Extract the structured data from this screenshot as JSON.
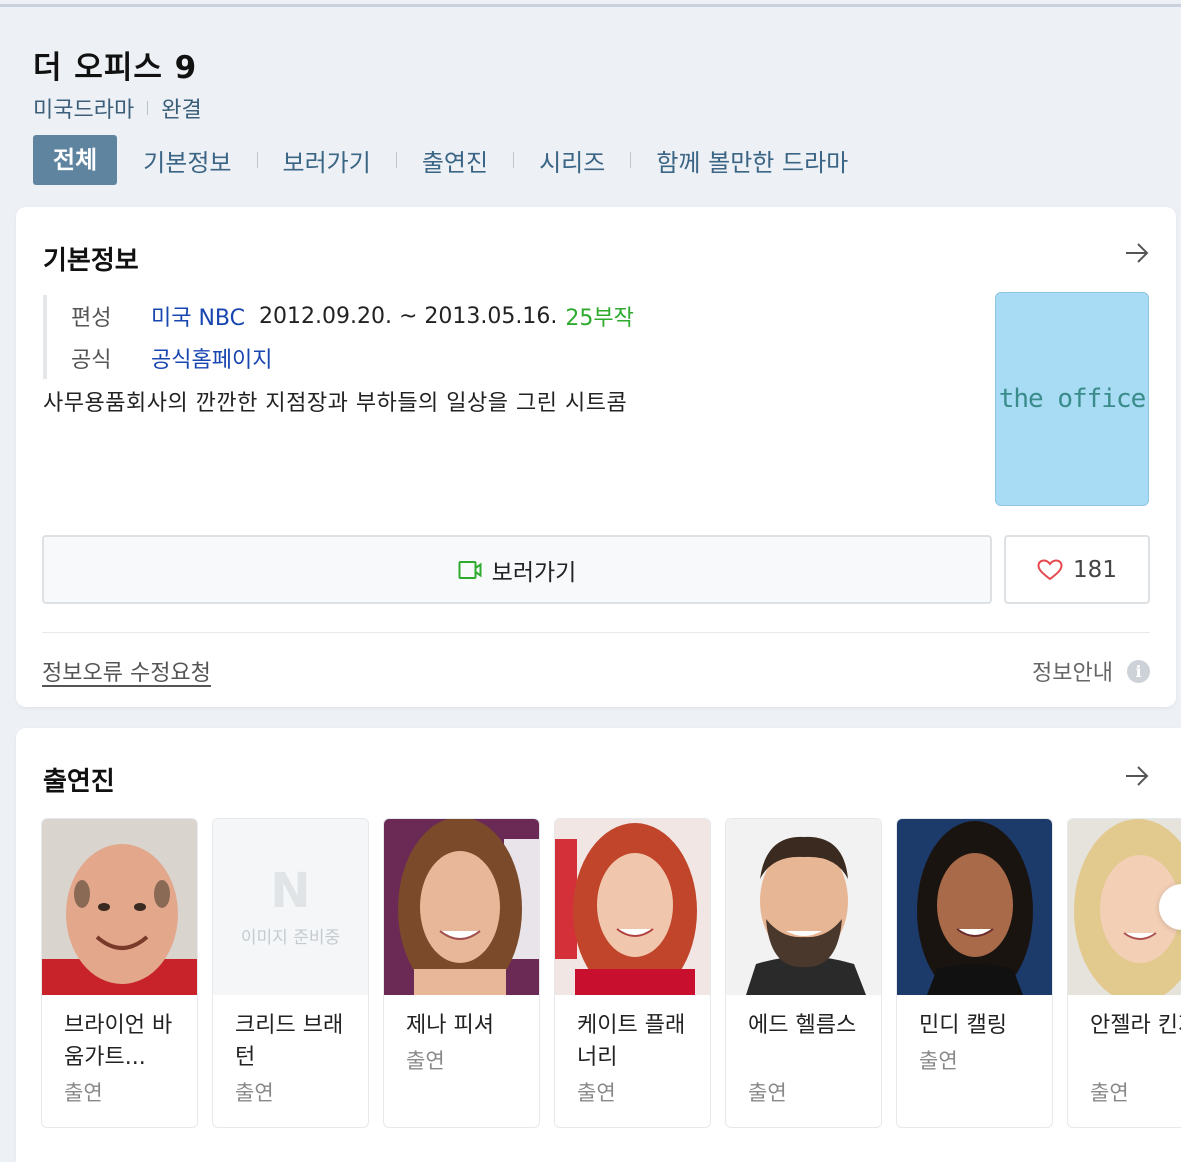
{
  "header": {
    "title": "더 오피스 9",
    "genre": "미국드라마",
    "status": "완결"
  },
  "tabs": [
    {
      "label": "전체",
      "active": true
    },
    {
      "label": "기본정보"
    },
    {
      "label": "보러가기"
    },
    {
      "label": "출연진"
    },
    {
      "label": "시리즈"
    },
    {
      "label": "함께 볼만한 드라마"
    }
  ],
  "basic_info": {
    "title": "기본정보",
    "broadcast_label": "편성",
    "broadcaster": "미국 NBC",
    "period": "2012.09.20. ~ 2013.05.16.",
    "episodes": "25부작",
    "official_label": "공식",
    "homepage": "공식홈페이지",
    "description": "사무용품회사의 깐깐한 지점장과 부하들의 일상을 그린 시트콤",
    "poster_text": "the office",
    "watch_label": "보러가기",
    "like_count": "181",
    "report_label": "정보오류 수정요청",
    "info_label": "정보안내",
    "info_icon": "i"
  },
  "cast": {
    "title": "출연진",
    "placeholder_logo": "N",
    "placeholder_text": "이미지 준비중",
    "members": [
      {
        "name": "브라이언 바움가트...",
        "role": "출연",
        "photo": "bald-man"
      },
      {
        "name": "크리드 브래턴",
        "role": "출연",
        "photo": "placeholder"
      },
      {
        "name": "제나 피셔",
        "role": "출연",
        "photo": "brunette-woman"
      },
      {
        "name": "케이트 플래너리",
        "role": "출연",
        "photo": "redhead-woman"
      },
      {
        "name": "에드 헬름스",
        "role": "출연",
        "photo": "bearded-man"
      },
      {
        "name": "민디 캘링",
        "role": "출연",
        "photo": "dark-hair-woman"
      },
      {
        "name": "안젤라 킨지",
        "role": "출연",
        "photo": "blonde-woman"
      }
    ]
  },
  "colors": {
    "accent": "#5e84a0",
    "link": "#1846b0",
    "episode_green": "#2eaa2e",
    "poster_bg": "#a8dcf4"
  }
}
